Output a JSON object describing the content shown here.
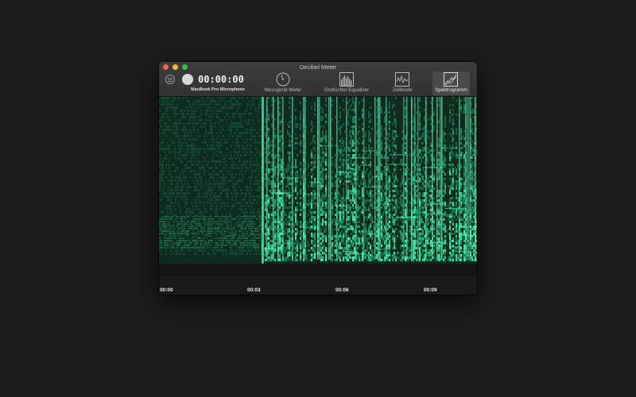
{
  "window": {
    "title": "Decibel Meter"
  },
  "toolbar": {
    "timer": "00:00:00",
    "device": "MacBook Pro Microphone",
    "tools": [
      {
        "label": "Messgerät Meter",
        "icon": "gauge-icon",
        "active": false
      },
      {
        "label": "Grafischer Equalizer",
        "icon": "equalizer-icon",
        "active": false
      },
      {
        "label": "Zeitleiste",
        "icon": "timeline-icon",
        "active": false
      },
      {
        "label": "Spektrogramm",
        "icon": "spectrogram-icon",
        "active": true
      }
    ]
  },
  "timeline": {
    "ticks": [
      "00:00",
      "00:03",
      "00:06",
      "00:09"
    ]
  },
  "colors": {
    "accent": "#2fe6a2",
    "spectro_dark": "#0d261a",
    "close": "#fc5f57",
    "minimize": "#fdbc2e",
    "maximize": "#28c841"
  }
}
